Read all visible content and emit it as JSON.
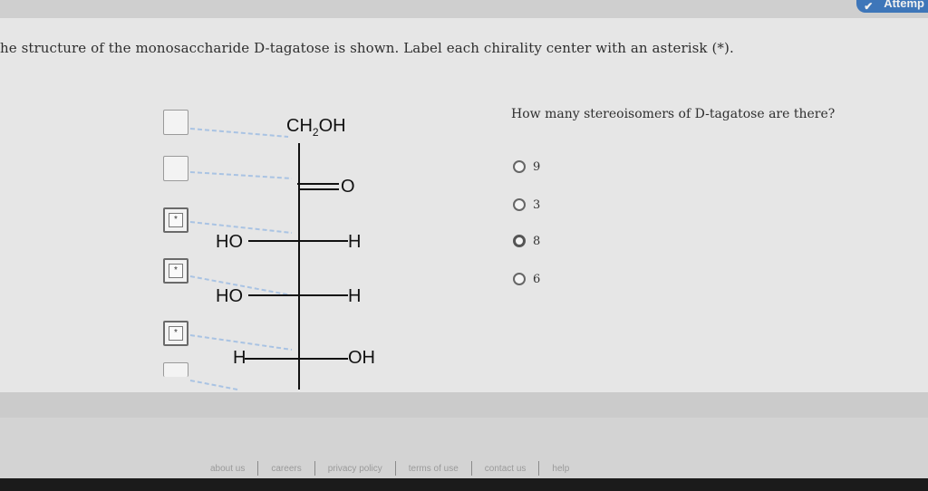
{
  "header": {
    "attempt_label": "Attemp"
  },
  "question": {
    "prompt": "he structure of the monosaccharide D-tagatose is shown. Label each chirality center with an asterisk (*).",
    "side_question": "How many stereoisomers of D-tagatose are there?"
  },
  "molecule": {
    "top_group": "CH",
    "top_sub": "2",
    "top_end": "OH",
    "carbonyl": "O",
    "rows": [
      {
        "left": "HO",
        "right": "H"
      },
      {
        "left": "HO",
        "right": "H"
      },
      {
        "left": "H",
        "right": "OH"
      }
    ]
  },
  "label_boxes": [
    {
      "mark": ""
    },
    {
      "mark": ""
    },
    {
      "mark": "*"
    },
    {
      "mark": "*"
    },
    {
      "mark": "*"
    },
    {
      "mark": ""
    }
  ],
  "options": [
    {
      "label": "9",
      "selected": false
    },
    {
      "label": "3",
      "selected": false
    },
    {
      "label": "8",
      "selected": true
    },
    {
      "label": "6",
      "selected": false
    }
  ],
  "footer": {
    "links": [
      "about us",
      "careers",
      "privacy policy",
      "terms of use",
      "contact us",
      "help"
    ]
  }
}
